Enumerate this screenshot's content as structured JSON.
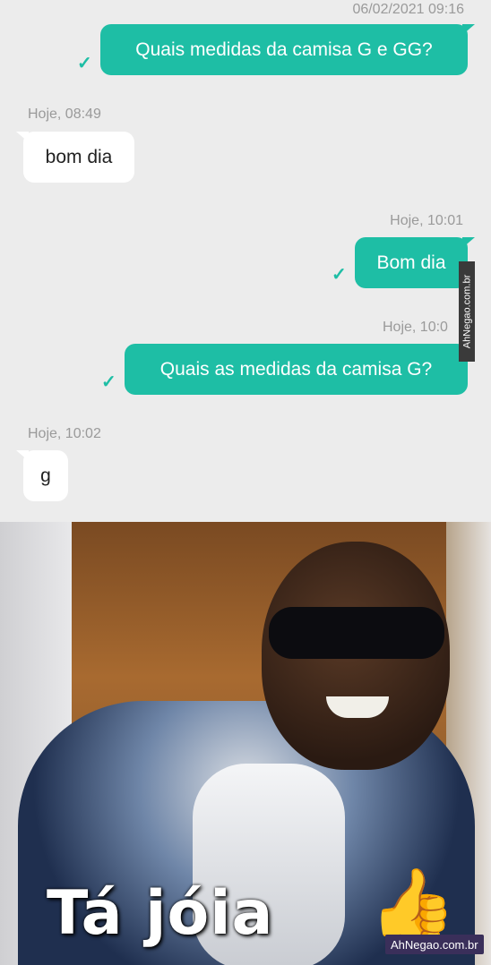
{
  "chat": {
    "messages": [
      {
        "direction": "outgoing",
        "timestamp": "06/02/2021 09:16",
        "text": "Quais medidas da camisa G e GG?",
        "status_icon": "check-icon"
      },
      {
        "direction": "incoming",
        "timestamp": "Hoje, 08:49",
        "text": "bom dia"
      },
      {
        "direction": "outgoing",
        "timestamp": "Hoje, 10:01",
        "text": "Bom dia",
        "status_icon": "check-icon"
      },
      {
        "direction": "outgoing",
        "timestamp": "Hoje, 10:0",
        "text": "Quais as medidas da camisa G?",
        "status_icon": "check-icon"
      },
      {
        "direction": "incoming",
        "timestamp": "Hoje, 10:02",
        "text": "g"
      }
    ],
    "check_glyph": "✓",
    "watermark_side": "AhNegao.com.br"
  },
  "meme": {
    "caption": "Tá jóia",
    "emoji": "👍",
    "watermark": "AhNegao.com.br"
  },
  "colors": {
    "outgoing_bubble": "#1ebea5",
    "incoming_bubble": "#ffffff",
    "chat_background": "#ececec",
    "timestamp": "#9a9a9a"
  }
}
